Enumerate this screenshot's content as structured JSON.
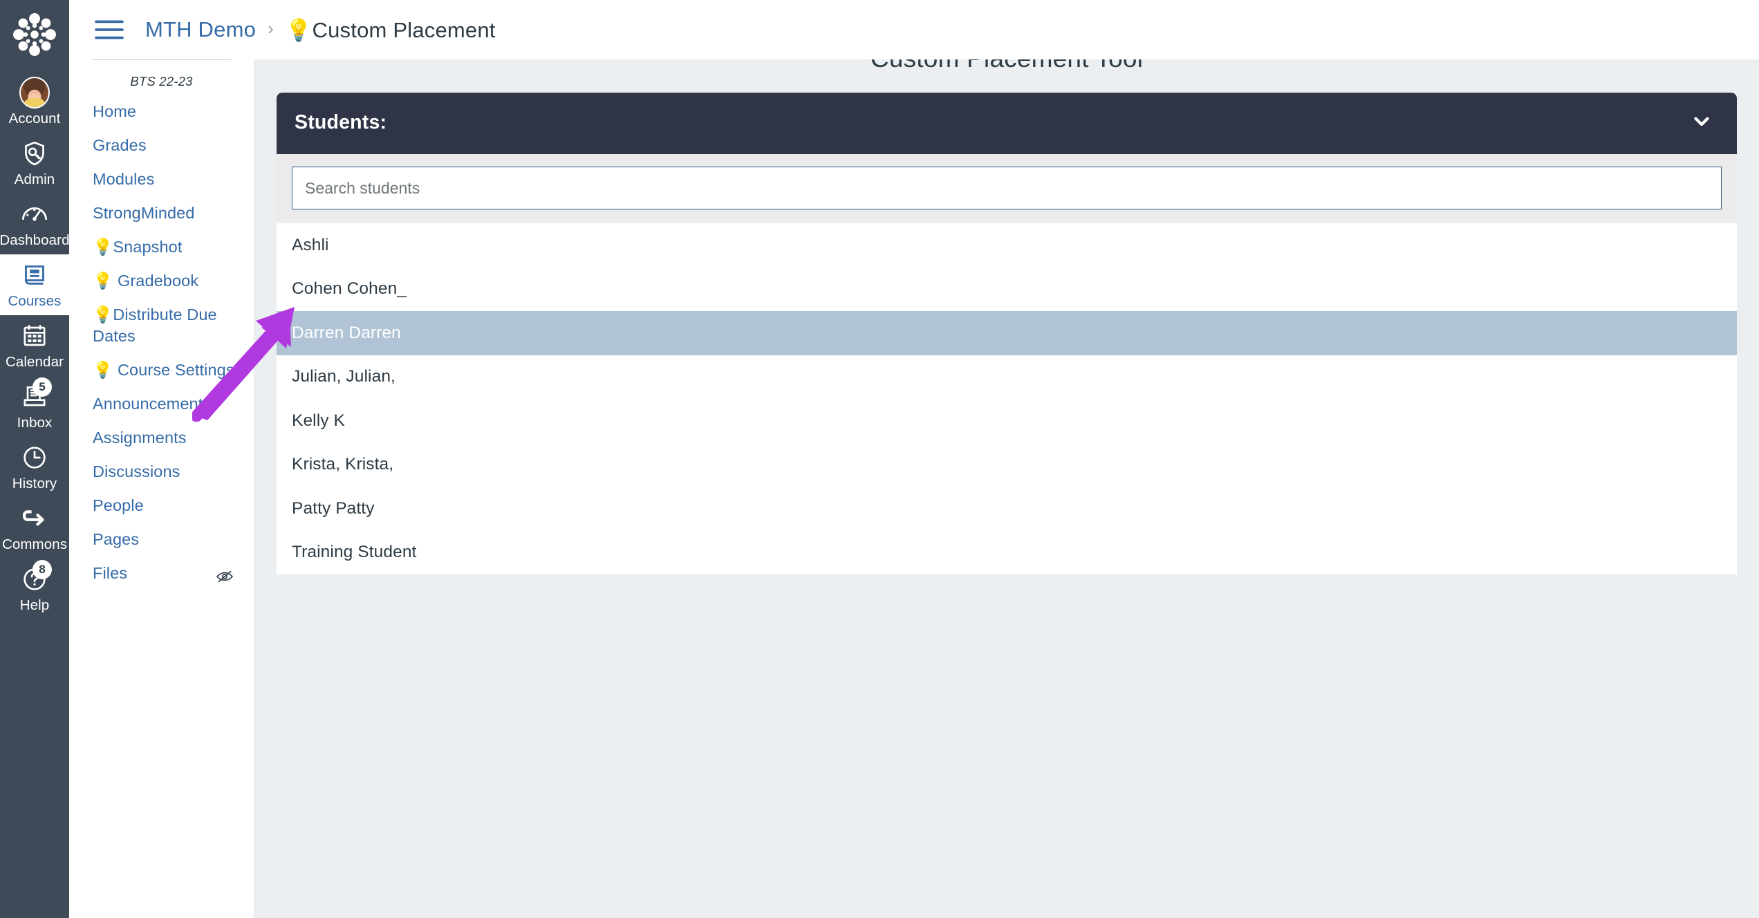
{
  "global_nav": {
    "logo_icon": "canvas-logo-icon",
    "items": [
      {
        "label": "Account",
        "icon": "avatar-icon",
        "active": false,
        "badge": ""
      },
      {
        "label": "Admin",
        "icon": "shield-key-icon",
        "active": false,
        "badge": ""
      },
      {
        "label": "Dashboard",
        "icon": "gauge-icon",
        "active": false,
        "badge": ""
      },
      {
        "label": "Courses",
        "icon": "book-icon",
        "active": true,
        "badge": ""
      },
      {
        "label": "Calendar",
        "icon": "calendar-icon",
        "active": false,
        "badge": ""
      },
      {
        "label": "Inbox",
        "icon": "inbox-icon",
        "active": false,
        "badge": "5"
      },
      {
        "label": "History",
        "icon": "clock-icon",
        "active": false,
        "badge": ""
      },
      {
        "label": "Commons",
        "icon": "commons-arrow-icon",
        "active": false,
        "badge": ""
      },
      {
        "label": "Help",
        "icon": "question-mark-icon",
        "active": false,
        "badge": "8"
      }
    ]
  },
  "header": {
    "hamburger_icon": "hamburger-menu-icon",
    "breadcrumb": [
      {
        "label": "MTH Demo",
        "link": true
      },
      {
        "label": "💡Custom Placement",
        "link": false
      }
    ],
    "breadcrumb_separator": "›"
  },
  "course_nav": {
    "term": "BTS 22-23",
    "items": [
      {
        "label": "Home",
        "hidden_icon": false
      },
      {
        "label": "Grades",
        "hidden_icon": false
      },
      {
        "label": "Modules",
        "hidden_icon": false
      },
      {
        "label": "StrongMinded",
        "hidden_icon": false
      },
      {
        "label": "💡Snapshot",
        "hidden_icon": false
      },
      {
        "label": "💡 Gradebook",
        "hidden_icon": false
      },
      {
        "label": "💡Distribute Due Dates",
        "hidden_icon": false
      },
      {
        "label": "💡 Course Settings",
        "hidden_icon": false
      },
      {
        "label": "Announcements",
        "hidden_icon": false
      },
      {
        "label": "Assignments",
        "hidden_icon": false
      },
      {
        "label": "Discussions",
        "hidden_icon": false
      },
      {
        "label": "People",
        "hidden_icon": false
      },
      {
        "label": "Pages",
        "hidden_icon": false
      },
      {
        "label": "Files",
        "hidden_icon": true
      }
    ]
  },
  "main": {
    "page_title": "Custom Placement Tool",
    "students_panel": {
      "title": "Students:",
      "collapse_icon": "chevron-down-icon",
      "search": {
        "value": "",
        "placeholder": "Search students"
      },
      "students": [
        {
          "name": "Ashli",
          "selected": false
        },
        {
          "name": "Cohen Cohen_",
          "selected": false
        },
        {
          "name": "Darren Darren",
          "selected": true
        },
        {
          "name": "Julian, Julian,",
          "selected": false
        },
        {
          "name": "Kelly K",
          "selected": false
        },
        {
          "name": "Krista, Krista,",
          "selected": false
        },
        {
          "name": "Patty Patty",
          "selected": false
        },
        {
          "name": "Training Student",
          "selected": false
        }
      ]
    }
  },
  "annotation": {
    "arrow_icon": "purple-arrow-icon",
    "arrow_color": "#b139e0"
  },
  "colors": {
    "global_nav_bg": "#3f4a58",
    "link_blue": "#356ba8",
    "panel_header_bg": "#2f3446",
    "selected_row_bg": "#b1c4d6",
    "content_bg": "#ebeff1",
    "search_band_bg": "#ebebeb",
    "text_dark": "#2d3b45"
  }
}
